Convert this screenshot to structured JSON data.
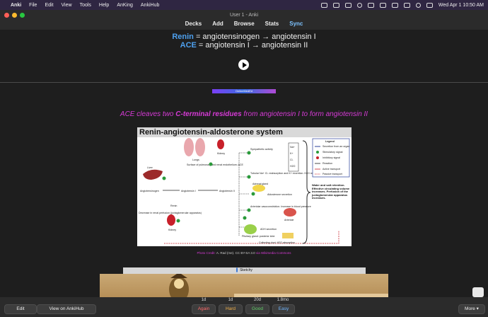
{
  "menubar": {
    "app": "Anki",
    "items": [
      "File",
      "Edit",
      "View",
      "Tools",
      "Help",
      "AnKing",
      "AnkiHub"
    ],
    "datetime": "Wed Apr 1  10:50 AM"
  },
  "window": {
    "title": "User 1 - Anki"
  },
  "toolbar": {
    "decks": "Decks",
    "add": "Add",
    "browse": "Browse",
    "stats": "Stats",
    "sync": "Sync"
  },
  "card": {
    "line1_kw": "Renin",
    "line1_rest": " = angiotensinogen → angiotensin I",
    "line2_kw": "ACE",
    "line2_rest": " = angiotensin I → angiotensin II",
    "oml_label": "OnlineMedEd",
    "back_pre": "ACE cleaves two ",
    "back_bold": "C-terminal residues",
    "back_post": " from angiotensin I to form angiotensin II",
    "diagram_title": "Renin-angiotensin-aldosterone system",
    "credit_pre": "Photo Credit: ",
    "credit_mid": "A. Rad (me). CC BY-SA 3.0",
    "credit_post": " via Wikimedia Commons",
    "sketchy_label": "Sketchy"
  },
  "diagram_labels": {
    "lungs": "Lungs",
    "liver": "Liver",
    "kidney": "Kidney",
    "surface": "Surface of pulmonary and renal endothelium: ACE",
    "angiotensinogen": "Angiotensinogen",
    "angiotensin1": "Angiotensin I",
    "angiotensin2": "Angiotensin II",
    "renin": "Renin",
    "decrease": "Decrease in renal perfusion (juxtaglomerular apparatus)",
    "sympathetic": "Sympathetic activity",
    "tubular": "Tubular Na+ Cl- reabsorption and K+ excretion. H2O retention",
    "adrenal": "Adrenal gland",
    "aldosterone": "Aldosterone secretion",
    "arteriolar": "Arteriolar vasoconstriction. Increase in blood pressure",
    "arteriole": "Arteriole",
    "pituitary": "Pituitary gland: posterior lobe",
    "adh": "ADH secretion",
    "collecting": "Collecting duct: H2O absorption",
    "water": "Water and salt retention. Effective circulating volume increases. Perfusion of the juxtaglomerular apparatus increases.",
    "legend_title": "Legend",
    "legend_items": [
      "Secretion from an organ",
      "Stimulatory signal",
      "Inhibitory signal",
      "Reaction",
      "Active transport",
      "Passive transport"
    ],
    "ions": [
      "Na+",
      "K+",
      "Cl-",
      "H2O"
    ]
  },
  "answer_buttons": [
    {
      "interval": "1d",
      "label": "Again",
      "color": "#ff6b6b"
    },
    {
      "interval": "1d",
      "label": "Hard",
      "color": "#f0b04a"
    },
    {
      "interval": "20d",
      "label": "Good",
      "color": "#63d26a"
    },
    {
      "interval": "1.8mo",
      "label": "Easy",
      "color": "#6fb6ff"
    }
  ],
  "bottom": {
    "edit": "Edit",
    "view_ankihub": "View on AnkiHub",
    "more": "More ▾"
  }
}
